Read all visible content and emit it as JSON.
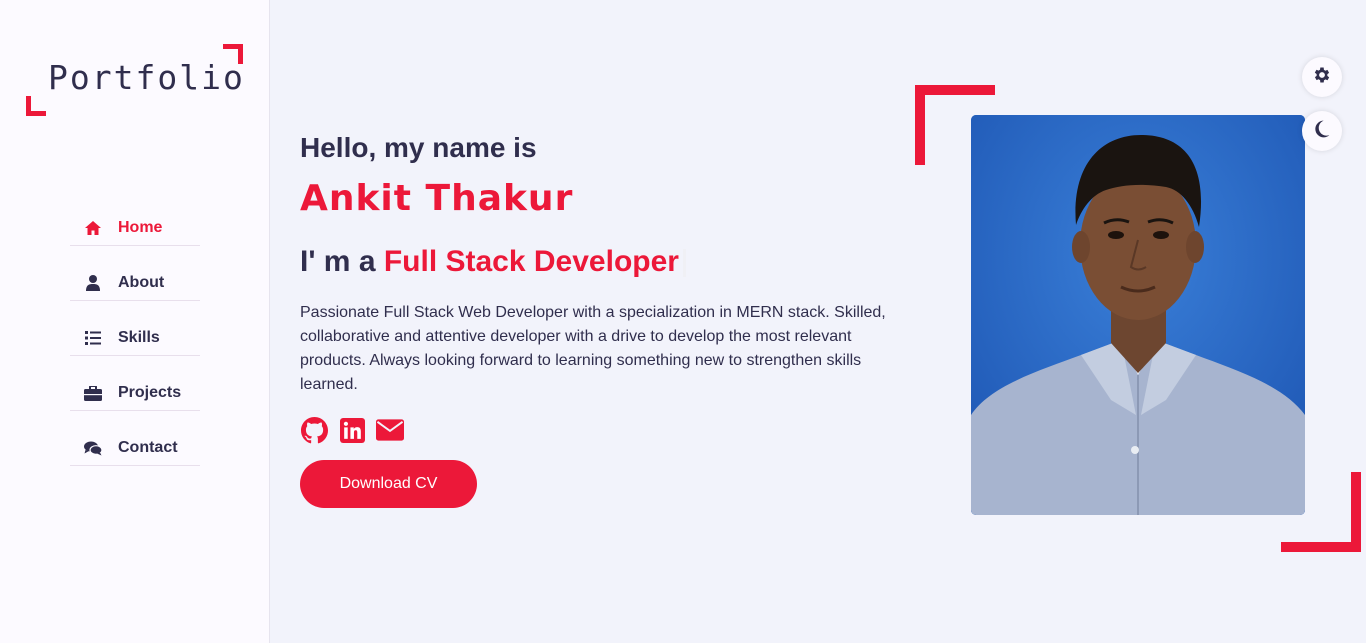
{
  "logo": {
    "text": "Portfolio"
  },
  "nav": {
    "items": [
      {
        "label": "Home",
        "icon": "home-icon",
        "active": true
      },
      {
        "label": "About",
        "icon": "user-icon",
        "active": false
      },
      {
        "label": "Skills",
        "icon": "list-icon",
        "active": false
      },
      {
        "label": "Projects",
        "icon": "briefcase-icon",
        "active": false
      },
      {
        "label": "Contact",
        "icon": "comments-icon",
        "active": false
      }
    ]
  },
  "hero": {
    "greeting": "Hello, my name is",
    "name": "Ankit Thakur",
    "role_prefix": "I' m a",
    "role_highlight": "Full Stack Developer",
    "bio": "Passionate Full Stack Web Developer with a specialization in MERN stack. Skilled, collaborative and attentive developer with a drive to develop the most relevant products. Always looking forward to learning something new to strengthen skills learned.",
    "socials": [
      "github-icon",
      "linkedin-icon",
      "envelope-icon"
    ],
    "cv_button": "Download CV"
  },
  "switcher": {
    "settings_icon": "gear-icon",
    "theme_icon": "moon-icon"
  },
  "colors": {
    "accent": "#ec1839",
    "text": "#302e4d",
    "bg": "#f2f3fb",
    "sidebar_bg": "#fcfaff"
  }
}
